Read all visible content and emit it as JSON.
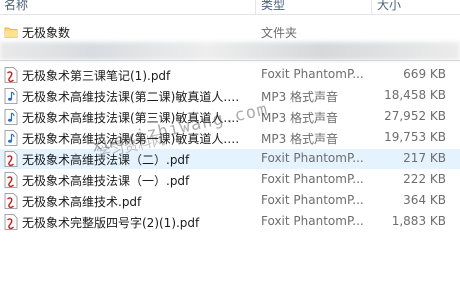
{
  "columns": {
    "name": "名称",
    "type": "类型",
    "size": "大小"
  },
  "folder": {
    "name": "无极象数",
    "type": "文件夹"
  },
  "files": [
    {
      "name": "无极象术第三课笔记(1).pdf",
      "type": "Foxit PhantomP...",
      "size": "669 KB",
      "icon": "pdf-icon"
    },
    {
      "name": "无极象术高维技法课(第二课)敏真道人.m...",
      "type": "MP3 格式声音",
      "size": "18,458 KB",
      "icon": "audio-icon"
    },
    {
      "name": "无极象术高维技法课(第三课)敏真道人.m...",
      "type": "MP3 格式声音",
      "size": "27,952 KB",
      "icon": "audio-icon"
    },
    {
      "name": "无极象术高维技法课(第一课)敏真道人.m...",
      "type": "MP3 格式声音",
      "size": "19,753 KB",
      "icon": "audio-icon"
    },
    {
      "name": "无极象术高维技法课（二）.pdf",
      "type": "Foxit PhantomP...",
      "size": "217 KB",
      "icon": "pdf-icon"
    },
    {
      "name": "无极象术高维技法课（一）.pdf",
      "type": "Foxit PhantomP...",
      "size": "222 KB",
      "icon": "pdf-icon"
    },
    {
      "name": "无极象术高维技术.pdf",
      "type": "Foxit PhantomP...",
      "size": "364 KB",
      "icon": "pdf-icon"
    },
    {
      "name": "无极象术完整版四号字(2)(1).pdf",
      "type": "Foxit PhantomP...",
      "size": "1,883 KB",
      "icon": "pdf-icon"
    }
  ],
  "watermark": {
    "line1": "xuexizhiwang.com",
    "line2": "学习资料网"
  },
  "colors": {
    "selection": "#e5f3ff",
    "folder": "#f8d775",
    "pdf": "#c81e1e",
    "audio": "#2b6fc2"
  }
}
